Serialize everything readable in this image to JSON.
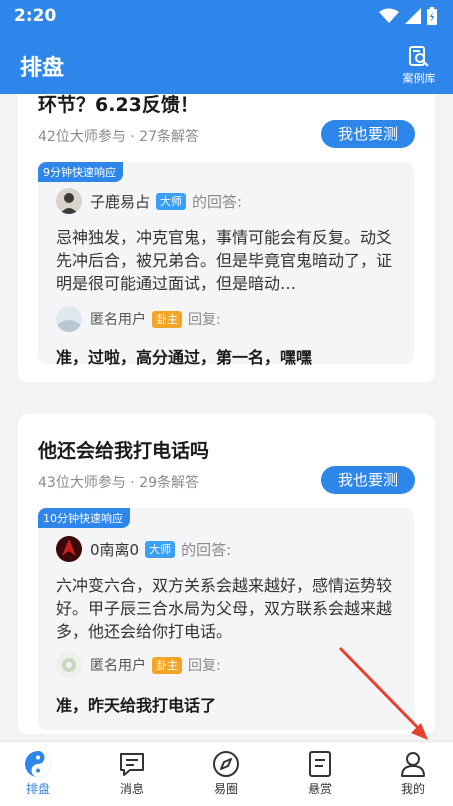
{
  "status": {
    "time": "2:20"
  },
  "header": {
    "title": "排盘",
    "case_label": "案例库"
  },
  "cards": [
    {
      "title": "环节？6.23反馈！",
      "meta": "42位大师参与 · 27条解答",
      "button": "我也要测",
      "tag": "9分钟快速响应",
      "answerer": "子鹿易占",
      "answerer_badge": "大师",
      "answer_suffix": "的回答:",
      "answer": "忌神独发，冲克官鬼，事情可能会有反复。动爻先冲后合，被兄弟合。但是毕竟官鬼暗动了，证明是很可能通过面试，但是暗动…",
      "replier": "匿名用户",
      "replier_badge": "卦主",
      "reply_suffix": "回复:",
      "reply": "准，过啦，高分通过，第一名，嘿嘿"
    },
    {
      "title": "他还会给我打电话吗",
      "meta": "43位大师参与 · 29条解答",
      "button": "我也要测",
      "tag": "10分钟快速响应",
      "answerer": "0南离0",
      "answerer_badge": "大师",
      "answer_suffix": "的回答:",
      "answer": "六冲变六合，双方关系会越来越好，感情运势较好。甲子辰三合水局为父母，双方联系会越来越多，他还会给你打电话。",
      "replier": "匿名用户",
      "replier_badge": "卦主",
      "reply_suffix": "回复:",
      "reply": "准，昨天给我打电话了"
    }
  ],
  "nav": [
    {
      "label": "排盘",
      "icon": "yin-yang-icon"
    },
    {
      "label": "消息",
      "icon": "message-icon"
    },
    {
      "label": "易圈",
      "icon": "compass-icon"
    },
    {
      "label": "悬赏",
      "icon": "document-icon"
    },
    {
      "label": "我的",
      "icon": "user-icon"
    }
  ],
  "colors": {
    "primary": "#2f86ea",
    "master_badge": "#3aa0f5",
    "owner_badge": "#f5a524",
    "arrow": "#e8402f"
  }
}
